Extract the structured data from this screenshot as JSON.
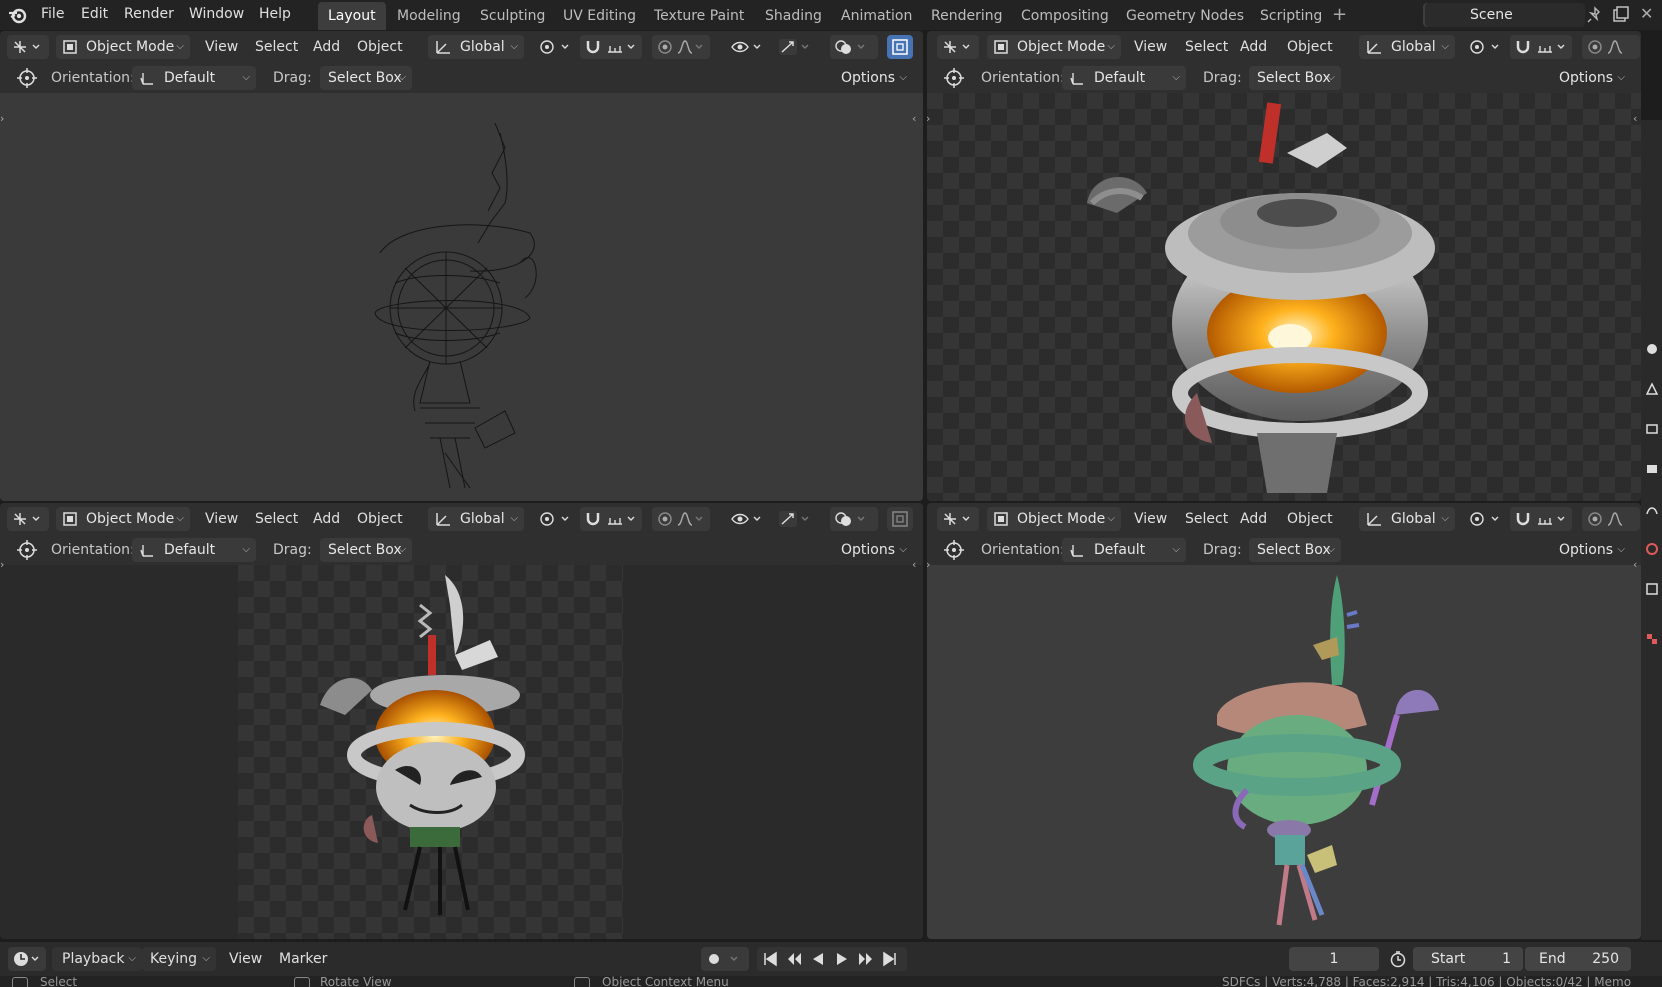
{
  "topbar": {
    "menus": [
      "File",
      "Edit",
      "Render",
      "Window",
      "Help"
    ],
    "workspaces": [
      "Layout",
      "Modeling",
      "Sculpting",
      "UV Editing",
      "Texture Paint",
      "Shading",
      "Animation",
      "Rendering",
      "Compositing",
      "Geometry Nodes",
      "Scripting"
    ],
    "active_workspace": "Layout",
    "add_workspace": "+",
    "scene": "Scene"
  },
  "viewport": {
    "mode": "Object Mode",
    "menus": [
      "View",
      "Select",
      "Add",
      "Object"
    ],
    "transform_orientation": "Global",
    "orientation_label": "Orientation:",
    "orientation_value": "Default",
    "drag_label": "Drag:",
    "drag_value": "Select Box",
    "options": "Options"
  },
  "timeline": {
    "menus": [
      "Playback",
      "Keying",
      "View",
      "Marker"
    ],
    "current_frame": "1",
    "start_label": "Start",
    "start_value": "1",
    "end_label": "End",
    "end_value": "250"
  },
  "statusbar": {
    "left": "Select",
    "middle": "Rotate View",
    "right": "Object Context Menu",
    "stats": "SDFCs | Verts:4,788 | Faces:2,914 | Tris:4,106 | Objects:0/42 | Memo"
  },
  "colors": {
    "accent": "#4772b3",
    "header": "#2f2f2f",
    "background": "#1d1d1d"
  }
}
